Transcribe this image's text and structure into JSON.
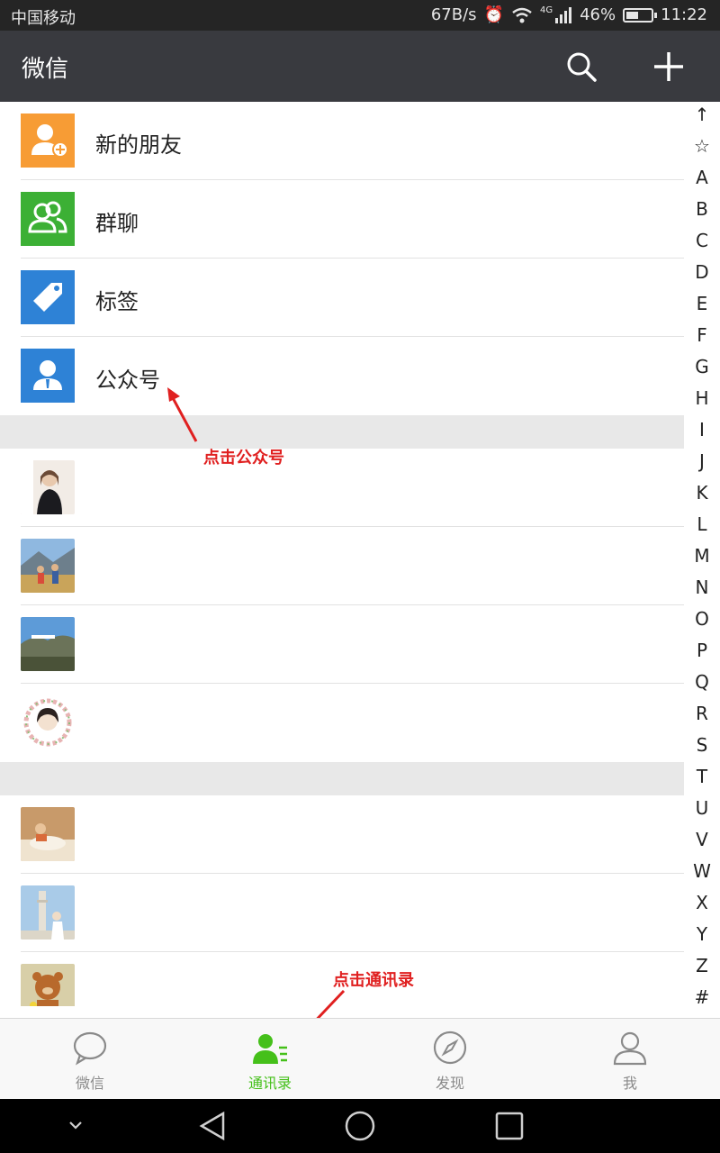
{
  "status_bar": {
    "carrier": "中国移动",
    "net_speed": "67B/s",
    "network": "4G",
    "battery": "46%",
    "time": "11:22"
  },
  "app_bar": {
    "title": "微信",
    "search_icon": "search-icon",
    "add_icon": "plus-icon"
  },
  "fixed_entries": [
    {
      "label": "新的朋友",
      "color": "#f79c35",
      "icon": "new-friend-icon"
    },
    {
      "label": "群聊",
      "color": "#3cb035",
      "icon": "group-chat-icon"
    },
    {
      "label": "标签",
      "color": "#2e82d6",
      "icon": "tag-icon"
    },
    {
      "label": "公众号",
      "color": "#2e82d6",
      "icon": "official-account-icon"
    }
  ],
  "index_letters": [
    "↑",
    "☆",
    "A",
    "B",
    "C",
    "D",
    "E",
    "F",
    "G",
    "H",
    "I",
    "J",
    "K",
    "L",
    "M",
    "N",
    "O",
    "P",
    "Q",
    "R",
    "S",
    "T",
    "U",
    "V",
    "W",
    "X",
    "Y",
    "Z",
    "#"
  ],
  "tabs": [
    {
      "label": "微信",
      "icon": "chat-bubble-icon",
      "active": false
    },
    {
      "label": "通讯录",
      "icon": "contacts-icon",
      "active": true
    },
    {
      "label": "发现",
      "icon": "compass-icon",
      "active": false
    },
    {
      "label": "我",
      "icon": "person-icon",
      "active": false
    }
  ],
  "annotations": {
    "click_official": "点击公众号",
    "click_contacts": "点击通讯录"
  },
  "colors": {
    "accent": "#45c01a",
    "appbar": "#393a3f",
    "annotation": "#e02020"
  }
}
